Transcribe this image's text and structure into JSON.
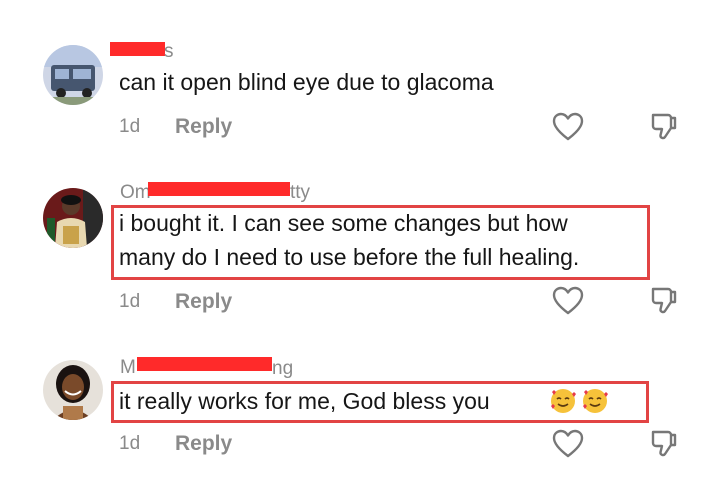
{
  "comments": [
    {
      "username_visible": "s",
      "text_lines": [
        "can it open blind eye due to glacoma"
      ],
      "time": "1d",
      "reply_label": "Reply",
      "highlighted": false
    },
    {
      "username_visible_start": "Om",
      "username_visible_end": "tty",
      "text_lines": [
        "i bought it. I can see some changes but how",
        "many do I need to use before the full healing."
      ],
      "time": "1d",
      "reply_label": "Reply",
      "highlighted": true
    },
    {
      "username_visible_start": "M",
      "username_visible_end": "ng",
      "text_lines": [
        "it really works for me, God bless you"
      ],
      "time": "1d",
      "reply_label": "Reply",
      "highlighted": true,
      "emojis": [
        "smiling-face-with-hearts",
        "smiling-face-with-hearts"
      ]
    }
  ],
  "icons": {
    "like": "heart-icon",
    "dislike": "thumbs-down-icon"
  },
  "colors": {
    "highlight_border": "#e24444",
    "redaction": "#ff2a2a",
    "muted_text": "#8a8a8a",
    "body_text": "#161616"
  }
}
